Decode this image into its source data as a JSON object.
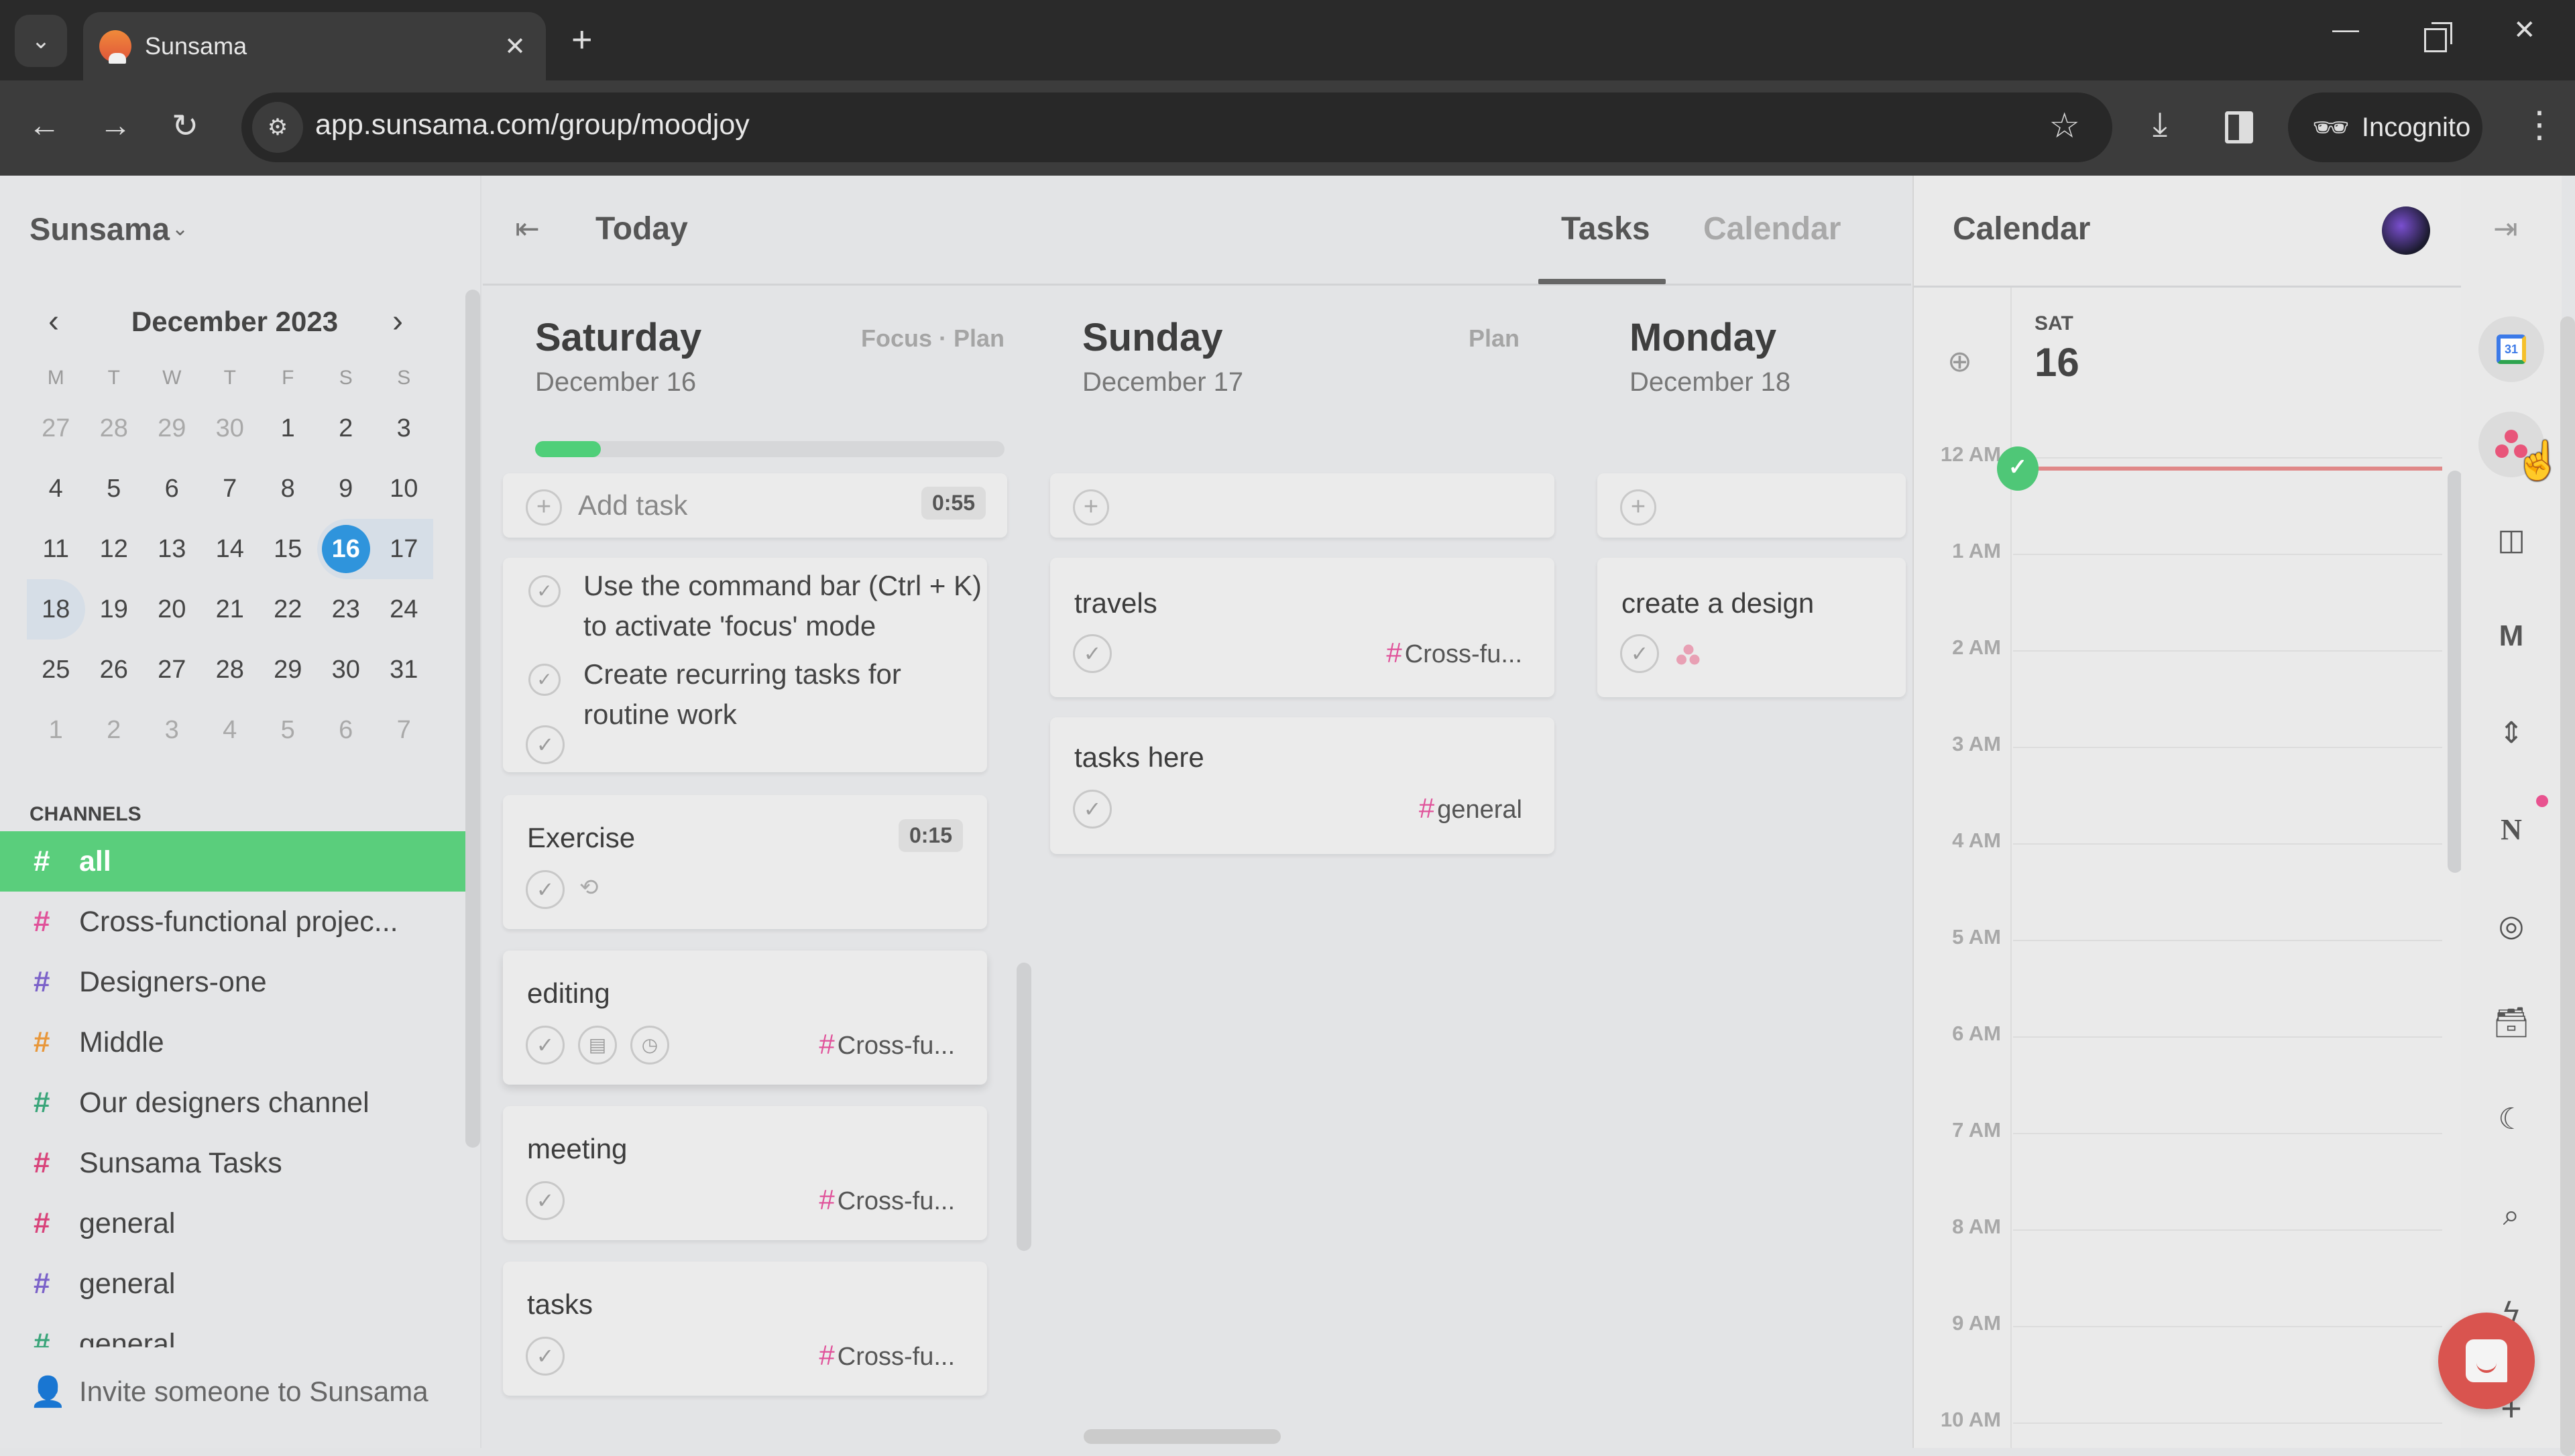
{
  "browser": {
    "tab_title": "Sunsama",
    "url": "app.sunsama.com/group/moodjoy",
    "incognito_label": "Incognito",
    "icons": {
      "tab_list": "chevron-down-icon",
      "tab_close": "close-icon",
      "new_tab": "plus-icon",
      "back": "arrow-left-icon",
      "forward": "arrow-right-icon",
      "reload": "reload-icon",
      "site_info": "tune-icon",
      "bookmark": "star-icon",
      "download": "download-icon",
      "side_panel": "side-panel-icon",
      "incognito": "incognito-icon",
      "menu": "kebab-icon"
    }
  },
  "sidebar": {
    "workspace": "Sunsama",
    "mini_calendar": {
      "title": "December 2023",
      "weekdays": [
        "M",
        "T",
        "W",
        "T",
        "F",
        "S",
        "S"
      ],
      "weeks": [
        [
          {
            "d": "27",
            "m": true
          },
          {
            "d": "28",
            "m": true
          },
          {
            "d": "29",
            "m": true
          },
          {
            "d": "30",
            "m": true
          },
          {
            "d": "1"
          },
          {
            "d": "2"
          },
          {
            "d": "3"
          }
        ],
        [
          {
            "d": "4"
          },
          {
            "d": "5"
          },
          {
            "d": "6"
          },
          {
            "d": "7"
          },
          {
            "d": "8"
          },
          {
            "d": "9"
          },
          {
            "d": "10"
          }
        ],
        [
          {
            "d": "11"
          },
          {
            "d": "12"
          },
          {
            "d": "13"
          },
          {
            "d": "14"
          },
          {
            "d": "15"
          },
          {
            "d": "16",
            "today": true
          },
          {
            "d": "17",
            "range": true
          }
        ],
        [
          {
            "d": "18",
            "rangeEnd": true
          },
          {
            "d": "19"
          },
          {
            "d": "20"
          },
          {
            "d": "21"
          },
          {
            "d": "22"
          },
          {
            "d": "23"
          },
          {
            "d": "24"
          }
        ],
        [
          {
            "d": "25"
          },
          {
            "d": "26"
          },
          {
            "d": "27"
          },
          {
            "d": "28"
          },
          {
            "d": "29"
          },
          {
            "d": "30"
          },
          {
            "d": "31"
          }
        ],
        [
          {
            "d": "1",
            "m": true
          },
          {
            "d": "2",
            "m": true
          },
          {
            "d": "3",
            "m": true
          },
          {
            "d": "4",
            "m": true
          },
          {
            "d": "5",
            "m": true
          },
          {
            "d": "6",
            "m": true
          },
          {
            "d": "7",
            "m": true
          }
        ]
      ]
    },
    "channels_title": "CHANNELS",
    "channels": [
      {
        "name": "all",
        "color": "#ffffff",
        "active": true
      },
      {
        "name": "Cross-functional projec...",
        "color": "#e0529a"
      },
      {
        "name": "Designers-one",
        "color": "#7b62c9"
      },
      {
        "name": "Middle",
        "color": "#e8973a"
      },
      {
        "name": "Our designers channel",
        "color": "#3aa57a"
      },
      {
        "name": "Sunsama Tasks",
        "color": "#d8437a"
      },
      {
        "name": "general",
        "color": "#d8437a"
      },
      {
        "name": "general",
        "color": "#7b62c9"
      },
      {
        "name": "general",
        "color": "#3aa57a"
      }
    ],
    "invite_label": "Invite someone to Sunsama"
  },
  "main": {
    "title": "Today",
    "tabs": [
      {
        "label": "Tasks",
        "active": true
      },
      {
        "label": "Calendar",
        "active": false
      }
    ],
    "days": [
      {
        "name": "Saturday",
        "date": "December 16",
        "actions": "Focus · Plan",
        "progress": 0.14,
        "add_label": "Add task",
        "add_time": "0:55",
        "subtasks": [
          "Use the command bar (Ctrl + K) to activate 'focus' mode",
          "Create recurring tasks for routine work"
        ],
        "tasks": [
          {
            "title": "Exercise",
            "time": "0:15"
          },
          {
            "title": "editing",
            "channel": "Cross-fu..."
          },
          {
            "title": "meeting",
            "channel": "Cross-fu..."
          },
          {
            "title": "tasks",
            "channel": "Cross-fu..."
          }
        ]
      },
      {
        "name": "Sunday",
        "date": "December 17",
        "actions": "Plan",
        "tasks": [
          {
            "title": "travels",
            "channel": "Cross-fu..."
          },
          {
            "title": "tasks here",
            "channel": "general"
          }
        ]
      },
      {
        "name": "Monday",
        "date": "December 18",
        "tasks": [
          {
            "title": "create a design",
            "integration": "asana-icon"
          }
        ]
      }
    ]
  },
  "calendar_panel": {
    "title": "Calendar",
    "day_of_week": "SAT",
    "day_number": "16",
    "hours": [
      "12 AM",
      "1 AM",
      "2 AM",
      "3 AM",
      "4 AM",
      "5 AM",
      "6 AM",
      "7 AM",
      "8 AM",
      "9 AM",
      "10 AM"
    ]
  },
  "rail": {
    "icons": [
      "google-calendar-icon",
      "asana-icon",
      "trello-icon",
      "gmail-icon",
      "linear-icon",
      "notion-icon",
      "target-icon",
      "archive-icon",
      "moon-icon",
      "search-icon",
      "lightning-icon",
      "plus-icon"
    ]
  },
  "colors": {
    "accent_green": "#5ace7c",
    "today_blue": "#2f94dc",
    "channel_pink": "#e0529a",
    "now_line": "#e08888",
    "chat_red": "#d9544f"
  }
}
